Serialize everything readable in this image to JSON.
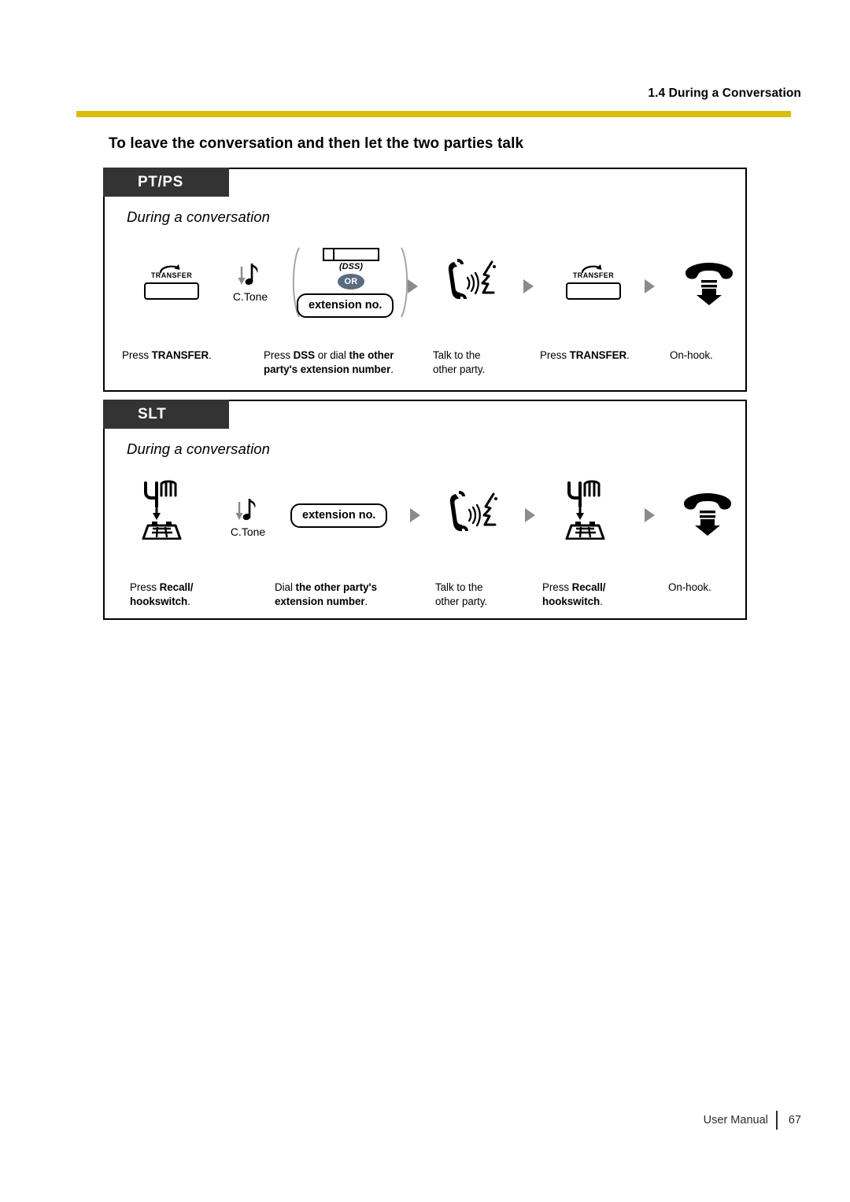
{
  "header": {
    "running_head": "1.4 During a Conversation",
    "rule_color": "#D8BD0E"
  },
  "section_title": "To leave the conversation and then let the two parties talk",
  "panels": [
    {
      "tab_label": "PT/PS",
      "subtitle": "During a conversation",
      "steps": [
        {
          "icon": "transfer-button-icon",
          "icon_label": "TRANSFER",
          "caption_parts": [
            {
              "text": "Press ",
              "bold": false
            },
            {
              "text": "TRANSFER",
              "bold": true
            },
            {
              "text": ".",
              "bold": false
            }
          ]
        },
        {
          "icon": "confirmation-tone-icon",
          "icon_label": "C.Tone"
        },
        {
          "icon": "dss-or-extension-group-icon",
          "dss_label": "(DSS)",
          "or_label": "OR",
          "extension_label": "extension no.",
          "caption_parts": [
            {
              "text": "Press ",
              "bold": false
            },
            {
              "text": "DSS",
              "bold": true
            },
            {
              "text": " or dial ",
              "bold": false
            },
            {
              "text": "the other party's extension number",
              "bold": true
            },
            {
              "text": ".",
              "bold": false
            }
          ]
        },
        {
          "icon": "talk-handset-icon",
          "caption_parts": [
            {
              "text": "Talk to the other party.",
              "bold": false
            }
          ]
        },
        {
          "icon": "transfer-button-icon",
          "icon_label": "TRANSFER",
          "caption_parts": [
            {
              "text": "Press ",
              "bold": false
            },
            {
              "text": "TRANSFER",
              "bold": true
            },
            {
              "text": ".",
              "bold": false
            }
          ]
        },
        {
          "icon": "on-hook-handset-icon",
          "caption_parts": [
            {
              "text": "On-hook.",
              "bold": false
            }
          ]
        }
      ]
    },
    {
      "tab_label": "SLT",
      "subtitle": "During a conversation",
      "steps": [
        {
          "icon": "recall-hookswitch-icon",
          "caption_parts": [
            {
              "text": "Press ",
              "bold": false
            },
            {
              "text": "Recall/ hookswitch",
              "bold": true
            },
            {
              "text": ".",
              "bold": false
            }
          ]
        },
        {
          "icon": "confirmation-tone-icon",
          "icon_label": "C.Tone"
        },
        {
          "icon": "extension-number-pill-icon",
          "extension_label": "extension no.",
          "caption_parts": [
            {
              "text": "Dial ",
              "bold": false
            },
            {
              "text": "the other party's extension number",
              "bold": true
            },
            {
              "text": ".",
              "bold": false
            }
          ]
        },
        {
          "icon": "talk-handset-icon",
          "caption_parts": [
            {
              "text": "Talk to the other party.",
              "bold": false
            }
          ]
        },
        {
          "icon": "recall-hookswitch-icon",
          "caption_parts": [
            {
              "text": "Press ",
              "bold": false
            },
            {
              "text": "Recall/ hookswitch",
              "bold": true
            },
            {
              "text": ".",
              "bold": false
            }
          ]
        },
        {
          "icon": "on-hook-handset-icon",
          "caption_parts": [
            {
              "text": "On-hook.",
              "bold": false
            }
          ]
        }
      ]
    }
  ],
  "ptps_captions": {
    "c1_a": "Press ",
    "c1_b": "TRANSFER",
    "c1_c": ".",
    "c2_a": "Press ",
    "c2_b": "DSS",
    "c2_c": " or dial ",
    "c2_d": "the other",
    "c2_e": "party's extension number",
    "c2_f": ".",
    "c3_a": "Talk to the",
    "c3_b": "other party.",
    "c4_a": "Press ",
    "c4_b": "TRANSFER",
    "c4_c": ".",
    "c5_a": "On-hook."
  },
  "slt_captions": {
    "c1_a": "Press ",
    "c1_b": "Recall/",
    "c1_c": "hookswitch",
    "c1_d": ".",
    "c2_a": "Dial ",
    "c2_b": "the other party's",
    "c2_c": "extension number",
    "c2_d": ".",
    "c3_a": "Talk to the",
    "c3_b": "other party.",
    "c4_a": "Press ",
    "c4_b": "Recall/",
    "c4_c": "hookswitch",
    "c4_d": ".",
    "c5_a": "On-hook."
  },
  "labels": {
    "transfer_key": "TRANSFER",
    "ctone": "C.Tone",
    "dss": "(DSS)",
    "or": "OR",
    "extension_no": "extension no."
  },
  "footer": {
    "manual_label": "User Manual",
    "page_number": "67"
  }
}
